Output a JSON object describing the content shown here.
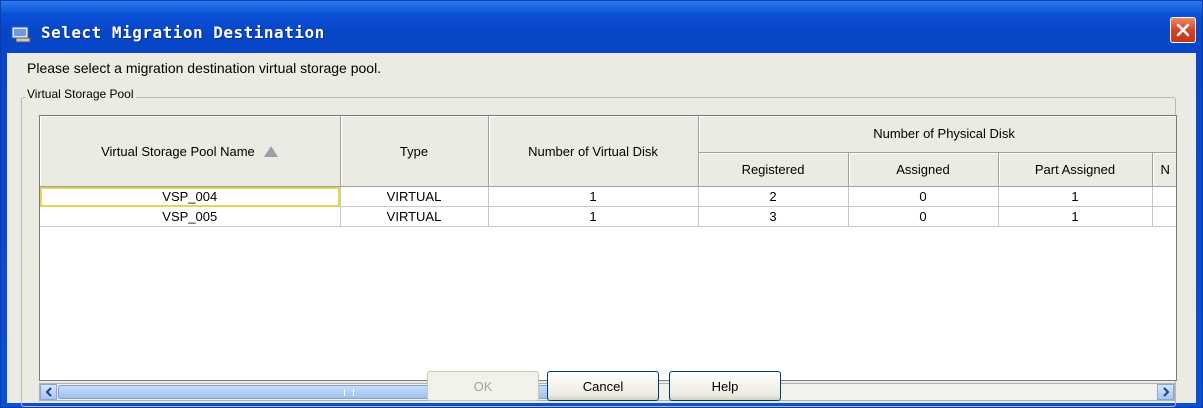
{
  "window": {
    "title": "Select Migration Destination"
  },
  "prompt": "Please select a migration destination virtual storage pool.",
  "group": {
    "label": "Virtual Storage Pool"
  },
  "table": {
    "headers": {
      "name": "Virtual Storage Pool Name",
      "type": "Type",
      "num_vdisk": "Number of Virtual Disk",
      "num_pdisk": "Number of Physical Disk",
      "registered": "Registered",
      "assigned": "Assigned",
      "part_assigned": "Part Assigned",
      "truncated": "N"
    },
    "rows": [
      {
        "name": "VSP_004",
        "type": "VIRTUAL",
        "num_vdisk": "1",
        "registered": "2",
        "assigned": "0",
        "part_assigned": "1",
        "extra": ""
      },
      {
        "name": "VSP_005",
        "type": "VIRTUAL",
        "num_vdisk": "1",
        "registered": "3",
        "assigned": "0",
        "part_assigned": "1",
        "extra": ""
      }
    ]
  },
  "buttons": {
    "ok": "OK",
    "cancel": "Cancel",
    "help": "Help"
  }
}
